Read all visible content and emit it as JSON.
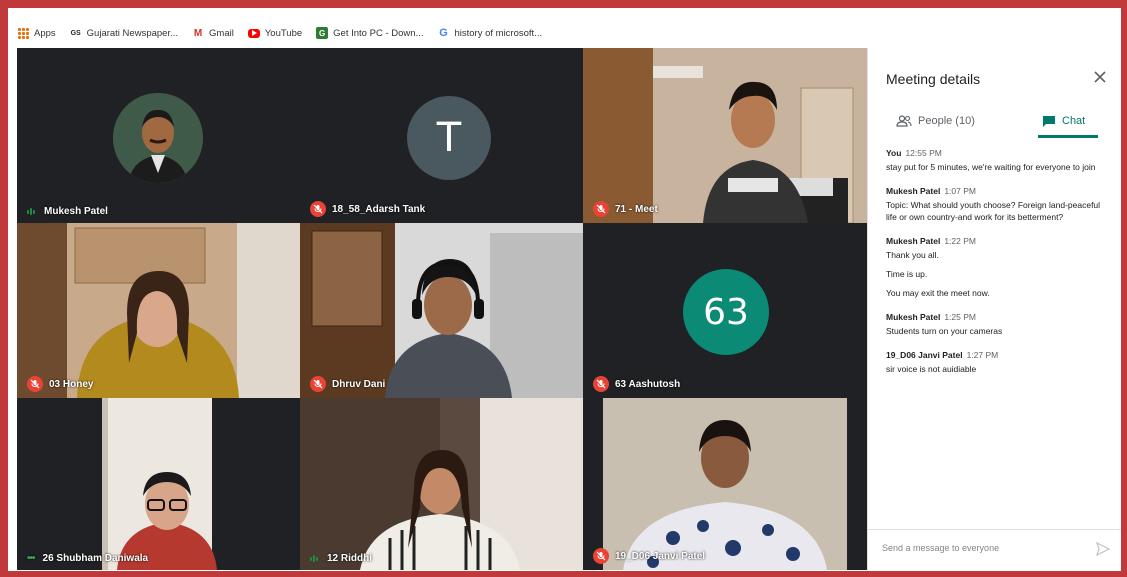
{
  "bookmarks": [
    {
      "label": "Apps",
      "icon": "apps-grid-icon"
    },
    {
      "label": "Gujarati Newspaper...",
      "icon": "newspaper-icon",
      "icon_text": "GS",
      "color": "#222"
    },
    {
      "label": "Gmail",
      "icon": "gmail-icon",
      "icon_text": "M",
      "color": "#d93025"
    },
    {
      "label": "YouTube",
      "icon": "youtube-icon",
      "color": "#ff0000"
    },
    {
      "label": "Get Into PC - Down...",
      "icon": "getintopc-icon",
      "icon_text": "G",
      "color": "#2e7d32"
    },
    {
      "label": "history of microsoft...",
      "icon": "google-icon",
      "icon_text": "G",
      "color": "#4285f4"
    }
  ],
  "participants": [
    {
      "name": "Mukesh Patel",
      "status": "speaking",
      "avatar": "photo"
    },
    {
      "name": "18_58_Adarsh Tank",
      "status": "muted",
      "avatar": "letter",
      "avatar_letter": "T",
      "avatar_color": "#4a5860"
    },
    {
      "name": "71 - Meet",
      "status": "muted",
      "avatar": "video"
    },
    {
      "name": "03 Honey",
      "status": "muted",
      "avatar": "video"
    },
    {
      "name": "Dhruv Dani",
      "status": "muted",
      "avatar": "video"
    },
    {
      "name": "63 Aashutosh",
      "status": "muted",
      "avatar": "letter",
      "avatar_letter": "63",
      "avatar_color": "#0b8a76"
    },
    {
      "name": "26 Shubham Daniwala",
      "status": "connecting",
      "avatar": "video"
    },
    {
      "name": "12 Riddhi",
      "status": "speaking",
      "avatar": "video"
    },
    {
      "name": "19_D06 Janvi Patel",
      "status": "muted",
      "avatar": "video"
    }
  ],
  "panel": {
    "title": "Meeting details",
    "tabs": [
      {
        "label": "People (10)",
        "icon": "people-icon"
      },
      {
        "label": "Chat",
        "icon": "chat-icon",
        "active": true
      }
    ],
    "messages": [
      {
        "sender": "You",
        "time": "12:55 PM",
        "lines": [
          "stay put for 5 minutes, we're waiting for everyone to join"
        ]
      },
      {
        "sender": "Mukesh Patel",
        "time": "1:07 PM",
        "lines": [
          "Topic: What should youth choose? Foreign land-peaceful life or own country-and work for its betterment?"
        ]
      },
      {
        "sender": "Mukesh Patel",
        "time": "1:22 PM",
        "lines": [
          "Thank you all.",
          "Time is up.",
          "You may exit the meet now."
        ]
      },
      {
        "sender": "Mukesh Patel",
        "time": "1:25 PM",
        "lines": [
          "Students turn on your cameras"
        ]
      },
      {
        "sender": "19_D06 Janvi Patel",
        "time": "1:27 PM",
        "lines": [
          "sir voice is not auidiable"
        ]
      }
    ],
    "compose_placeholder": "Send a message to everyone"
  },
  "colors": {
    "accent": "#00796b",
    "mute": "#ea4335",
    "speaking": "#1e8e3e"
  }
}
